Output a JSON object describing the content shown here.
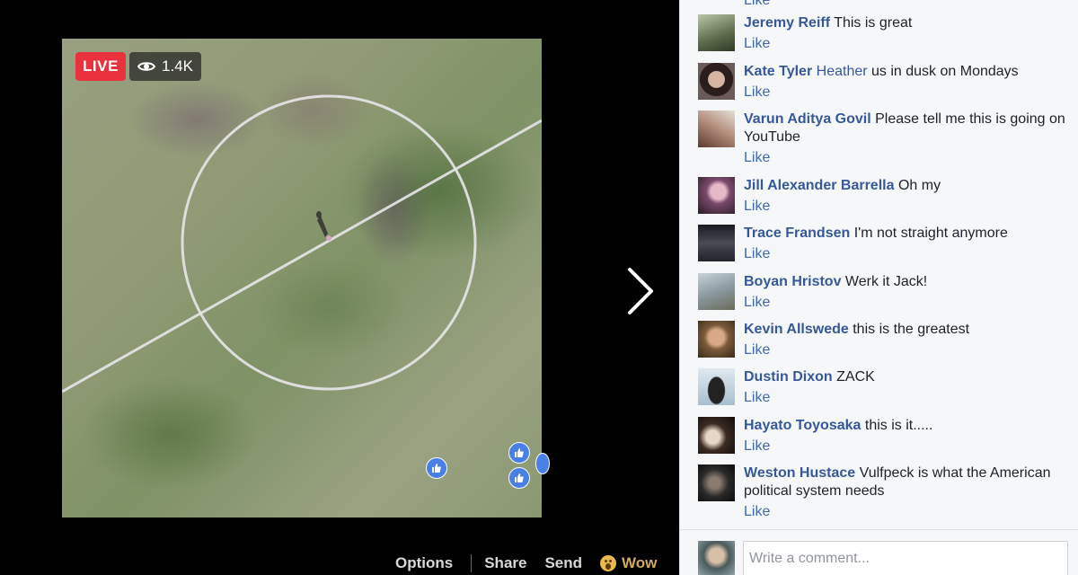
{
  "video": {
    "live_label": "LIVE",
    "viewer_count": "1.4K",
    "actions": {
      "options": "Options",
      "share": "Share",
      "send": "Send",
      "wow": "Wow"
    }
  },
  "comments_panel": {
    "top_partial_like": "Like",
    "comments": [
      {
        "name": "Jeremy Reiff",
        "text": "This is great",
        "like": "Like",
        "avatar_color": "#5b6b4a"
      },
      {
        "name": "Kate Tyler",
        "mention": "Heather",
        "text": "us in dusk on Mondays",
        "like": "Like",
        "avatar_color": "#4a3c3a"
      },
      {
        "name": "Varun Aditya Govil",
        "text": "Please tell me this is going on YouTube",
        "like": "Like",
        "avatar_color": "#8a6a5a"
      },
      {
        "name": "Jill Alexander Barrella",
        "text": "Oh my",
        "like": "Like",
        "avatar_color": "#7a4a6a"
      },
      {
        "name": "Trace Frandsen",
        "text": "I'm not straight anymore",
        "like": "Like",
        "avatar_color": "#3a3a42"
      },
      {
        "name": "Boyan Hristov",
        "text": "Werk it Jack!",
        "like": "Like",
        "avatar_color": "#8a9aa0"
      },
      {
        "name": "Kevin Allswede",
        "text": "this is the greatest",
        "like": "Like",
        "avatar_color": "#7a5a3a"
      },
      {
        "name": "Dustin Dixon",
        "text": "ZACK",
        "like": "Like",
        "avatar_color": "#a8c0d0"
      },
      {
        "name": "Hayato Toyosaka",
        "text": "this is it.....",
        "like": "Like",
        "avatar_color": "#3a2a22"
      },
      {
        "name": "Weston Hustace",
        "text": "Vulfpeck is what the American political system needs",
        "like": "Like",
        "avatar_color": "#2a2a2a"
      }
    ],
    "composer_placeholder": "Write a comment..."
  }
}
